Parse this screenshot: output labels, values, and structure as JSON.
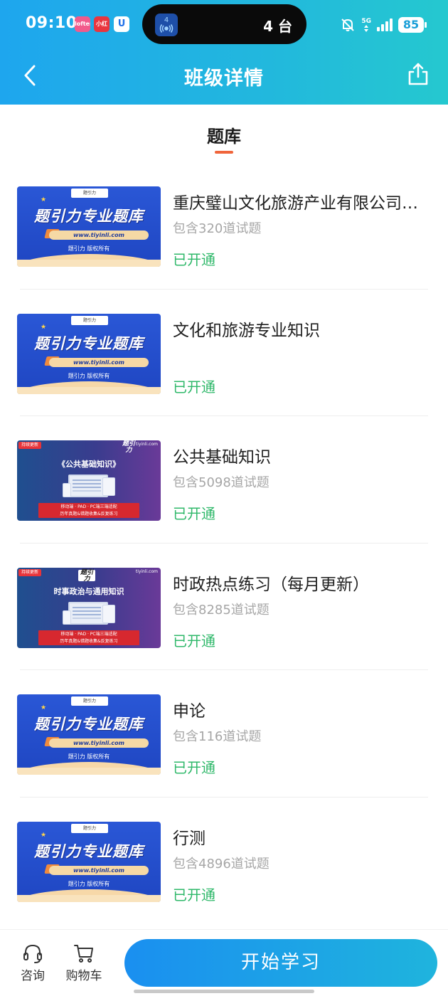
{
  "status_bar": {
    "time": "09:10",
    "app_badges": [
      "Lofter",
      "小红书",
      "U"
    ],
    "island_number": "4",
    "island_text": "4 台",
    "network": "5G",
    "battery": "85"
  },
  "nav": {
    "title": "班级详情",
    "back_icon": "chevron-left-icon",
    "share_icon": "share-icon"
  },
  "section": {
    "title": "题库",
    "underline_color": "#f0653b"
  },
  "thumbnail_text": {
    "brand_small": "题引力",
    "big_title": "题引力专业题库",
    "url": "www.tiyinli.com",
    "copyright": "题引力 版权所有",
    "tag": "持续更新",
    "site": "tiyinli.com",
    "brand_logo": "题引力",
    "promo_line1": "移动端 · PAD · PC端三端适配",
    "promo_line2": "历年真题&错题收集&反复练习"
  },
  "items": [
    {
      "title": "重庆璧山文化旅游产业有限公司招聘",
      "count": "包含320道试题",
      "status": "已开通",
      "thumb": "a",
      "subtitle": ""
    },
    {
      "title": "文化和旅游专业知识",
      "count": "",
      "status": "已开通",
      "thumb": "a",
      "subtitle": ""
    },
    {
      "title": "公共基础知识",
      "count": "包含5098道试题",
      "status": "已开通",
      "thumb": "b",
      "subtitle": "《公共基础知识》"
    },
    {
      "title": "时政热点练习（每月更新）",
      "count": "包含8285道试题",
      "status": "已开通",
      "thumb": "b",
      "subtitle": "时事政治与通用知识"
    },
    {
      "title": "申论",
      "count": "包含116道试题",
      "status": "已开通",
      "thumb": "a",
      "subtitle": ""
    },
    {
      "title": "行测",
      "count": "包含4896道试题",
      "status": "已开通",
      "thumb": "a",
      "subtitle": ""
    }
  ],
  "bottom_bar": {
    "consult_label": "咨询",
    "cart_label": "购物车",
    "start_button": "开始学习"
  },
  "colors": {
    "header_gradient_start": "#1ea6ee",
    "header_gradient_end": "#25c8cf",
    "status_opened": "#2fb86a",
    "button_gradient_start": "#1a8ff0",
    "button_gradient_end": "#1fb4dd"
  }
}
